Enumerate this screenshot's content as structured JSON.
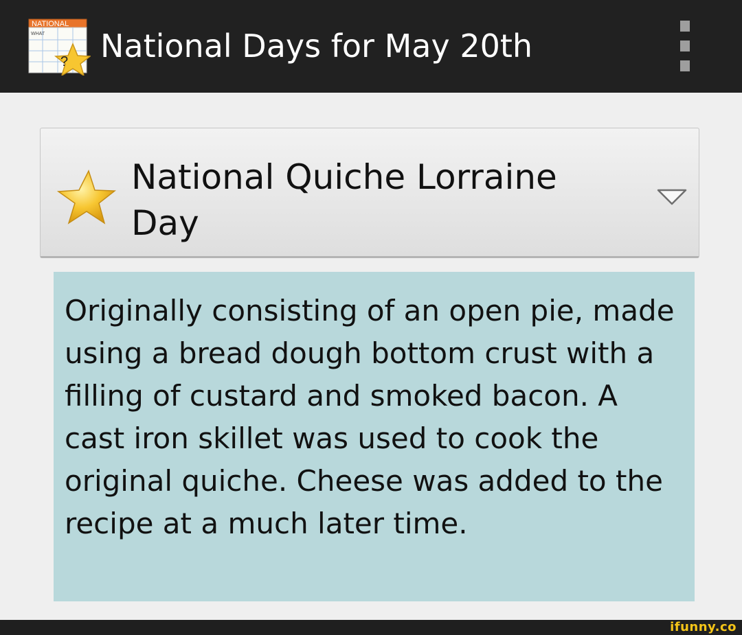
{
  "app": {
    "icon_top_label": "NATIONAL",
    "icon_sub_label": "WHAT",
    "icon_glyph": "?",
    "title": "National Days for May 20th",
    "overflow_icon": "overflow-menu-icon"
  },
  "day_card": {
    "title": "National Quiche Lorraine Day",
    "icon": "star-icon",
    "expand_icon": "chevron-down-icon"
  },
  "description": {
    "text": "Originally consisting of an open pie, made using a bread dough bottom crust with a filling of custard and smoked bacon. A cast iron skillet was used to cook the original quiche. Cheese was added to the recipe at a much later time."
  },
  "watermark": {
    "text": "ifunny.co"
  },
  "colors": {
    "appbar": "#212121",
    "background": "#efefef",
    "description_bg": "#b8d8db",
    "star": "#f7c631",
    "icon_label_bg": "#e8742a"
  }
}
